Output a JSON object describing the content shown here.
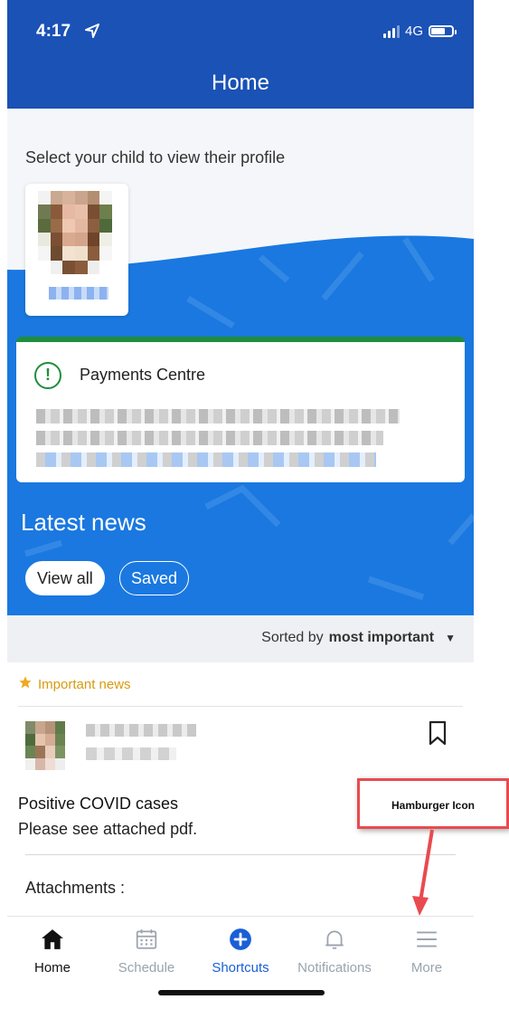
{
  "status_bar": {
    "time": "4:17",
    "network": "4G"
  },
  "header": {
    "title": "Home"
  },
  "children": {
    "prompt": "Select your child to view their profile"
  },
  "payments": {
    "title": "Payments Centre"
  },
  "news": {
    "title": "Latest news",
    "filters": [
      {
        "label": "View all",
        "active": true
      },
      {
        "label": "Saved",
        "active": false
      }
    ],
    "sort_prefix": "Sorted by",
    "sort_value": "most important",
    "important_label": "Important news",
    "post": {
      "title": "Positive COVID cases",
      "body": "Please see attached pdf.",
      "attachments_label": "Attachments :"
    }
  },
  "tabbar": {
    "items": [
      {
        "label": "Home",
        "icon": "house-icon",
        "color": "#111111"
      },
      {
        "label": "Schedule",
        "icon": "calendar-icon",
        "color": "#9aa3ad"
      },
      {
        "label": "Shortcuts",
        "icon": "plus-circle-icon",
        "color": "#1a5fd6"
      },
      {
        "label": "Notifications",
        "icon": "bell-icon",
        "color": "#9aa3ad"
      },
      {
        "label": "More",
        "icon": "hamburger-icon",
        "color": "#9aa3ad"
      }
    ]
  },
  "annotation": {
    "label": "Hamburger Icon",
    "color": "#e94a4f"
  },
  "colors": {
    "brand": "#1a52b5",
    "accent_blue": "#1a78e0",
    "success": "#1e8e3e",
    "important": "#d89a12"
  }
}
